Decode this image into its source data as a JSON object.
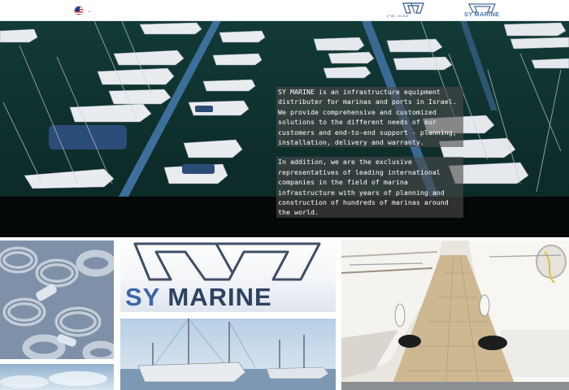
{
  "header": {
    "language_flag": "us-flag-icon",
    "language_chevron": "⌄",
    "logo_hebrew_text": "אס.ווי. מרין",
    "logo_english_text": "SY MARINE"
  },
  "hero": {
    "paragraphs": [
      " SY MARINE is an infrastructure equipment distributer for marinas and ports in Israel. We provide comprehensive and customized solutions to the different needs of our customers and end-to-end support - planning, installation, delivery and warranty.",
      "In addition, we are the exclusive representatives of leading international companies in the field of marina infrastructure with years of planning and construction of hundreds of marinas around the world."
    ]
  },
  "brand_tile": {
    "brand_strong": "SY",
    "brand_rest": " MARINE"
  },
  "colors": {
    "brand_blue": "#3c67a6",
    "brand_dark": "#2e4260",
    "hero_water": "#0f2e2a",
    "text_overlay": "#4b4b4b"
  }
}
